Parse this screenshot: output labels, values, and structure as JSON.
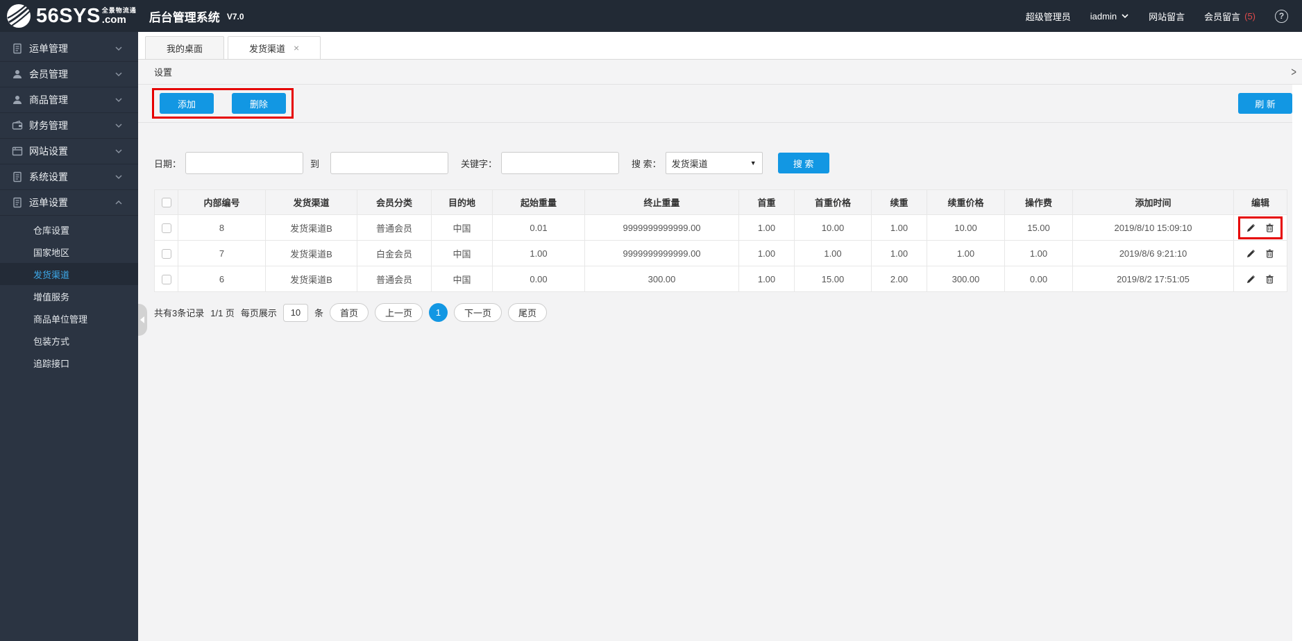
{
  "header": {
    "logo_text": "56SYS",
    "logo_suffix": ".com",
    "logo_tagline": "全景物流通",
    "app_title": "后台管理系统",
    "version": "V7.0",
    "role": "超级管理员",
    "username": "iadmin",
    "nav_site_msg": "网站留言",
    "nav_member_msg": "会员留言",
    "member_msg_count": "(5)",
    "help_glyph": "?"
  },
  "sidebar": {
    "items": [
      {
        "label": "运单管理"
      },
      {
        "label": "会员管理"
      },
      {
        "label": "商品管理"
      },
      {
        "label": "财务管理"
      },
      {
        "label": "网站设置"
      },
      {
        "label": "系统设置"
      },
      {
        "label": "运单设置"
      }
    ],
    "submenu": [
      {
        "label": "仓库设置"
      },
      {
        "label": "国家地区"
      },
      {
        "label": "发货渠道"
      },
      {
        "label": "增值服务"
      },
      {
        "label": "商品单位管理"
      },
      {
        "label": "包装方式"
      },
      {
        "label": "追踪接口"
      }
    ]
  },
  "tabs": {
    "tab1": "我的桌面",
    "tab2": "发货渠道",
    "close_glyph": "×"
  },
  "panel": {
    "title": "设置",
    "chevron_glyph": ">"
  },
  "toolbar": {
    "add": "添加",
    "delete": "删除",
    "refresh": "刷 新"
  },
  "filters": {
    "date_label": "日期：",
    "to_label": "到",
    "keyword_label": "关键字：",
    "search_label": "搜 索：",
    "search_select_value": "发货渠道",
    "select_arrow": "▼",
    "search_button": "搜 索"
  },
  "table": {
    "columns": [
      "内部编号",
      "发货渠道",
      "会员分类",
      "目的地",
      "起始重量",
      "终止重量",
      "首重",
      "首重价格",
      "续重",
      "续重价格",
      "操作费",
      "添加时间",
      "编辑"
    ],
    "rows": [
      [
        "8",
        "发货渠道B",
        "普通会员",
        "中国",
        "0.01",
        "9999999999999.00",
        "1.00",
        "10.00",
        "1.00",
        "10.00",
        "15.00",
        "2019/8/10 15:09:10"
      ],
      [
        "7",
        "发货渠道B",
        "白金会员",
        "中国",
        "1.00",
        "9999999999999.00",
        "1.00",
        "1.00",
        "1.00",
        "1.00",
        "1.00",
        "2019/8/6 9:21:10"
      ],
      [
        "6",
        "发货渠道B",
        "普通会员",
        "中国",
        "0.00",
        "300.00",
        "1.00",
        "15.00",
        "2.00",
        "300.00",
        "0.00",
        "2019/8/2 17:51:05"
      ]
    ]
  },
  "pagination": {
    "summary": "共有3条记录",
    "page_info": "1/1 页",
    "per_page_label": "每页展示",
    "per_page_value": "10",
    "unit": "条",
    "first": "首页",
    "prev": "上一页",
    "current": "1",
    "next": "下一页",
    "last": "尾页"
  },
  "colors": {
    "accent": "#1297e3",
    "annotation_red": "#e60000",
    "header_bg": "#222a35",
    "sidebar_bg": "#2b3442",
    "active_link": "#3da8e8"
  }
}
